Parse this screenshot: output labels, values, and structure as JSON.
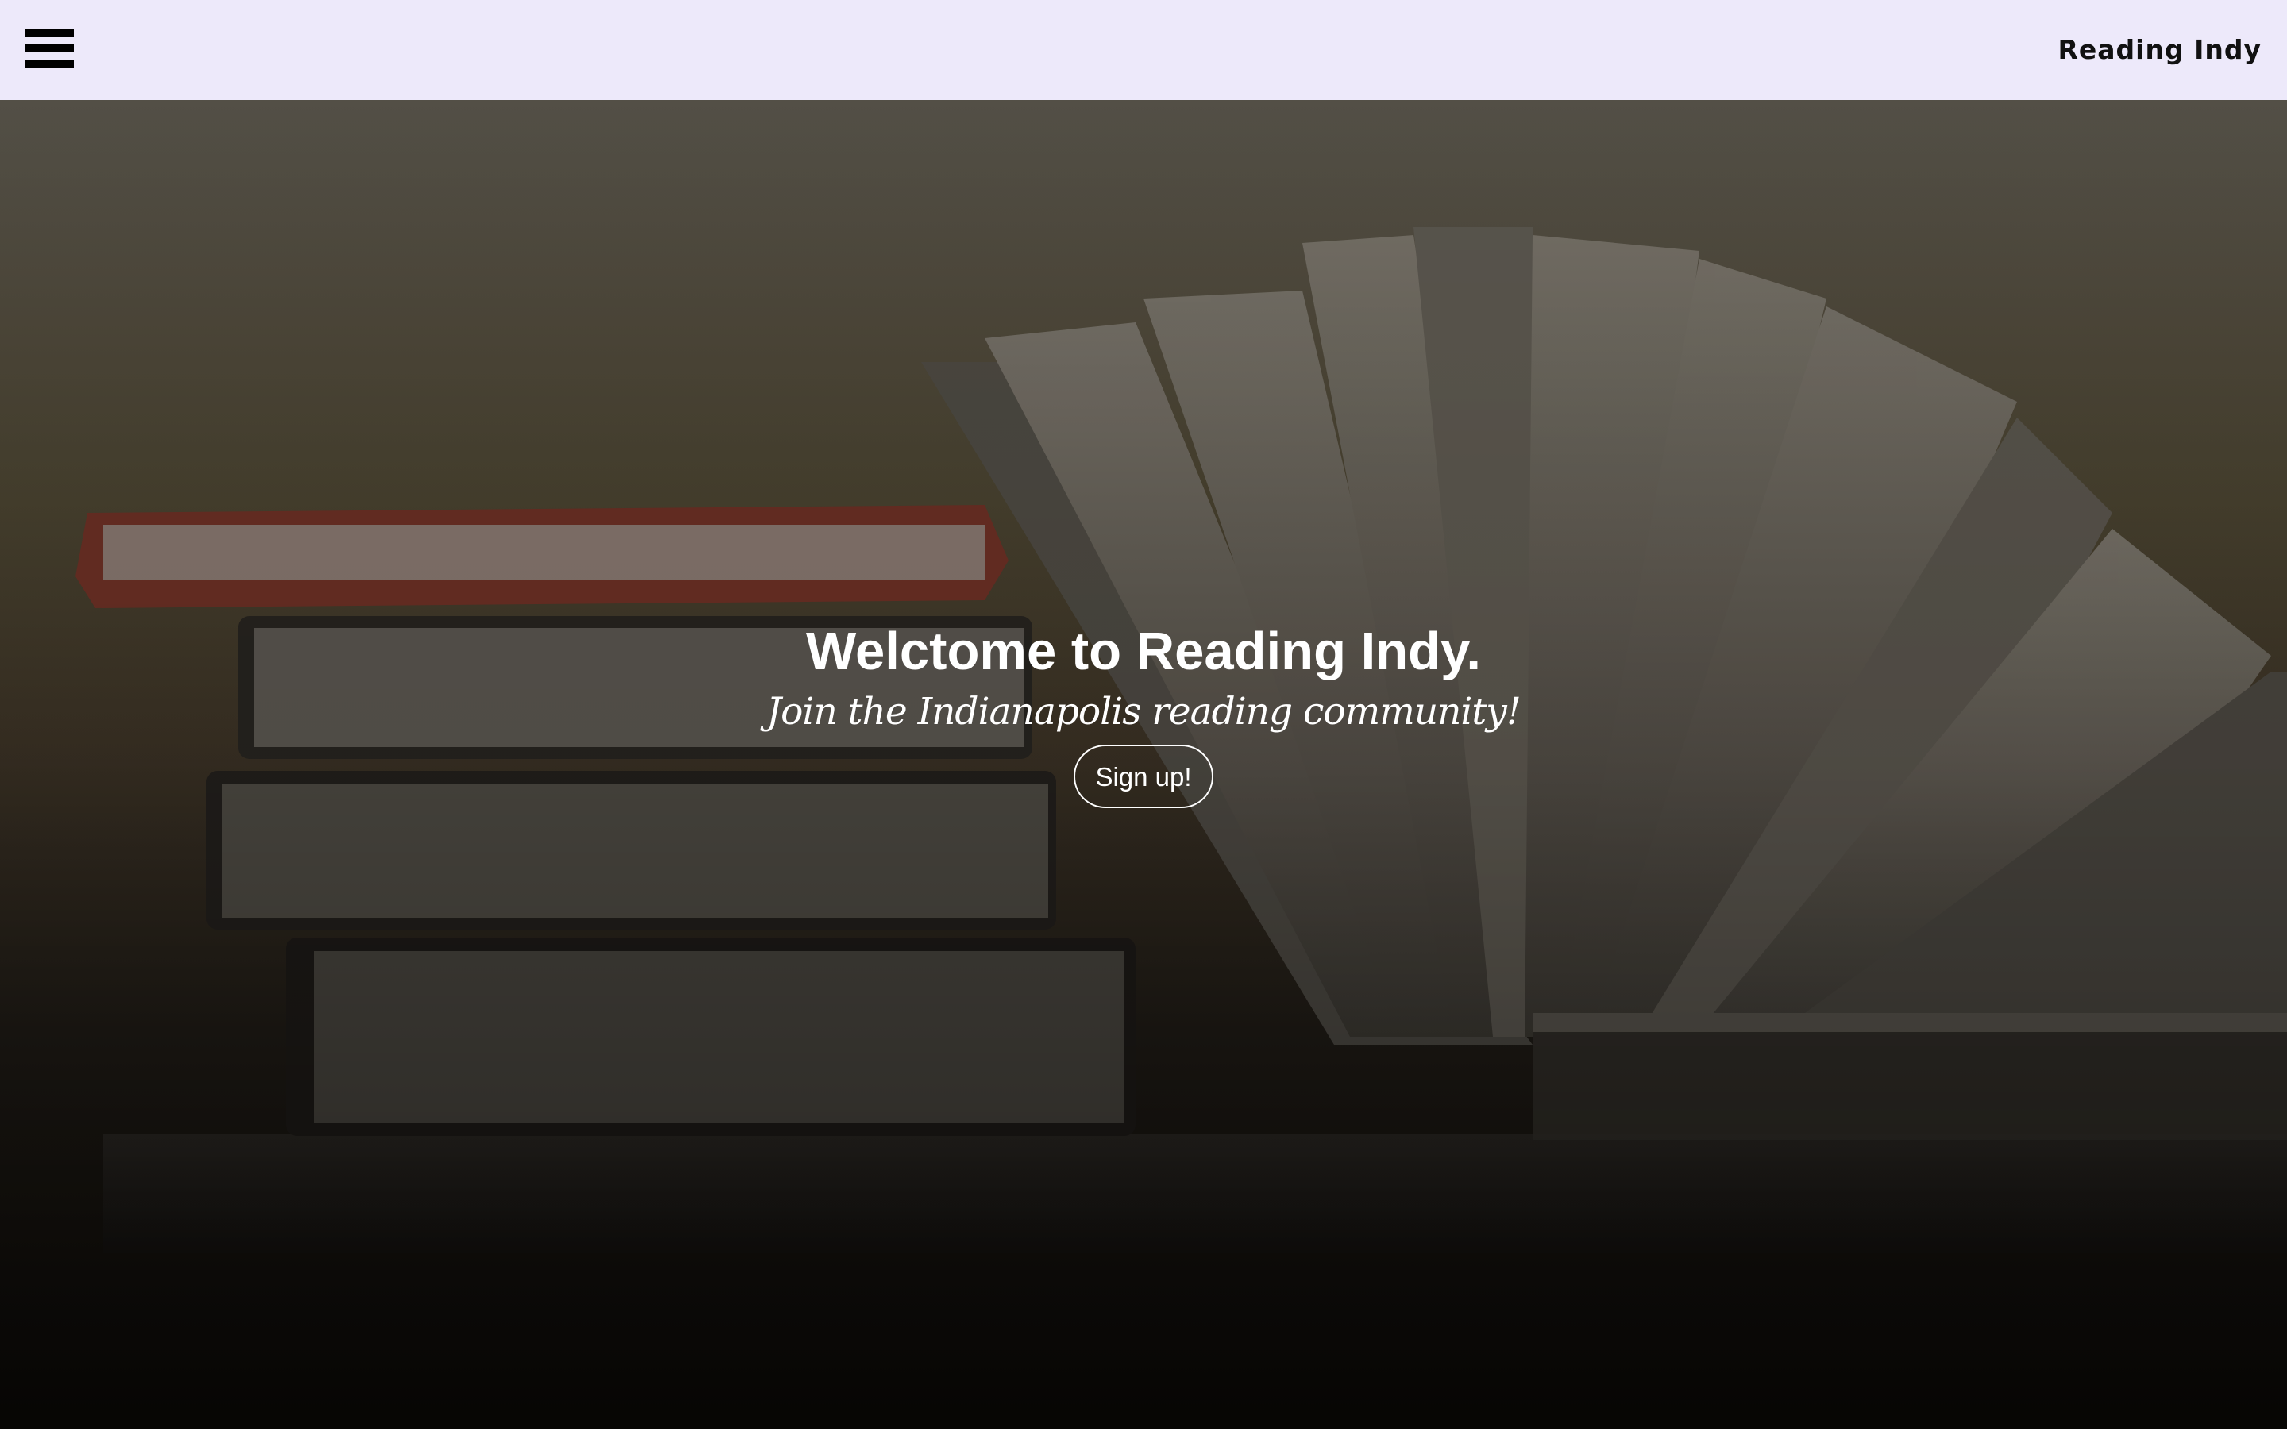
{
  "navbar": {
    "menu_icon": "hamburger-menu-icon",
    "brand_label": "Reading Indy",
    "background_color": "#ede9fa"
  },
  "hero": {
    "background_image": "stack of books and open book on a shelf",
    "title": "Welctome to Reading Indy.",
    "subtitle": "Join the Indianapolis reading community!",
    "signup_label": "Sign up!"
  }
}
